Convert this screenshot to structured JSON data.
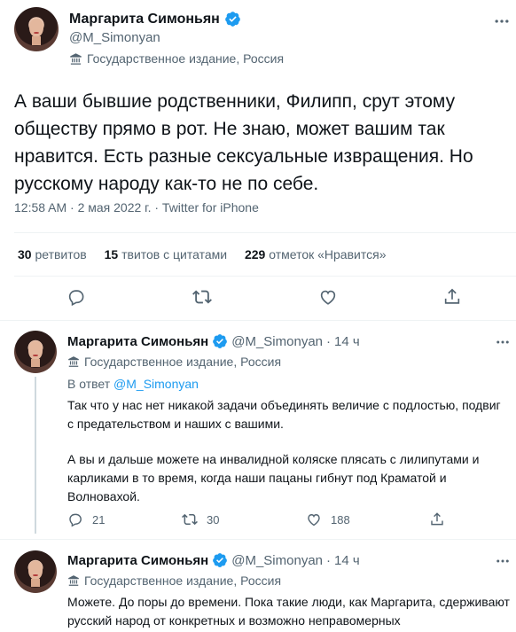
{
  "main_tweet": {
    "name": "Маргарита Симоньян",
    "handle": "@M_Simonyan",
    "label": "Государственное издание, Россия",
    "text": "А ваши бывшие родственники, Филипп, срут этому обществу прямо в рот. Не знаю, может вашим так нравится. Есть разные сексуальные извращения. Но русскому народу как-то не по себе.",
    "meta": "12:58 AM · 2 мая 2022 г. · Twitter for iPhone",
    "stats": [
      {
        "num": "30",
        "label": "ретвитов"
      },
      {
        "num": "15",
        "label": "твитов с цитатами"
      },
      {
        "num": "229",
        "label": "отметок «Нравится»"
      }
    ]
  },
  "reply1": {
    "name": "Маргарита Симоньян",
    "handle": "@M_Simonyan",
    "dot": "·",
    "time": "14 ч",
    "label": "Государственное издание, Россия",
    "in_reply_prefix": "В ответ",
    "in_reply_handle": "@M_Simonyan",
    "para1": "Так что у нас нет никакой задачи объединять величие с подлостью, подвиг с предательством и наших с вашими.",
    "para2": "А вы и дальше можете на инвалидной коляске плясать с лилипутами и карликами в то время, когда наши пацаны гибнут под Краматой и Волновахой.",
    "replies": "21",
    "retweets": "30",
    "likes": "188"
  },
  "reply2": {
    "name": "Маргарита Симоньян",
    "handle": "@M_Simonyan",
    "dot": "·",
    "time": "14 ч",
    "label": "Государственное издание, Россия",
    "text": "Можете. До поры до времени. Пока такие люди, как Маргарита, сдерживают русский народ от конкретных и возможно неправомерных"
  },
  "icons": [
    "verified-badge-icon",
    "more-icon",
    "state-media-icon",
    "reply-icon",
    "retweet-icon",
    "like-icon",
    "share-icon"
  ],
  "colors": {
    "accent": "#1d9bf0",
    "muted": "#536471",
    "text": "#0f1419",
    "divider": "#eff3f4"
  }
}
